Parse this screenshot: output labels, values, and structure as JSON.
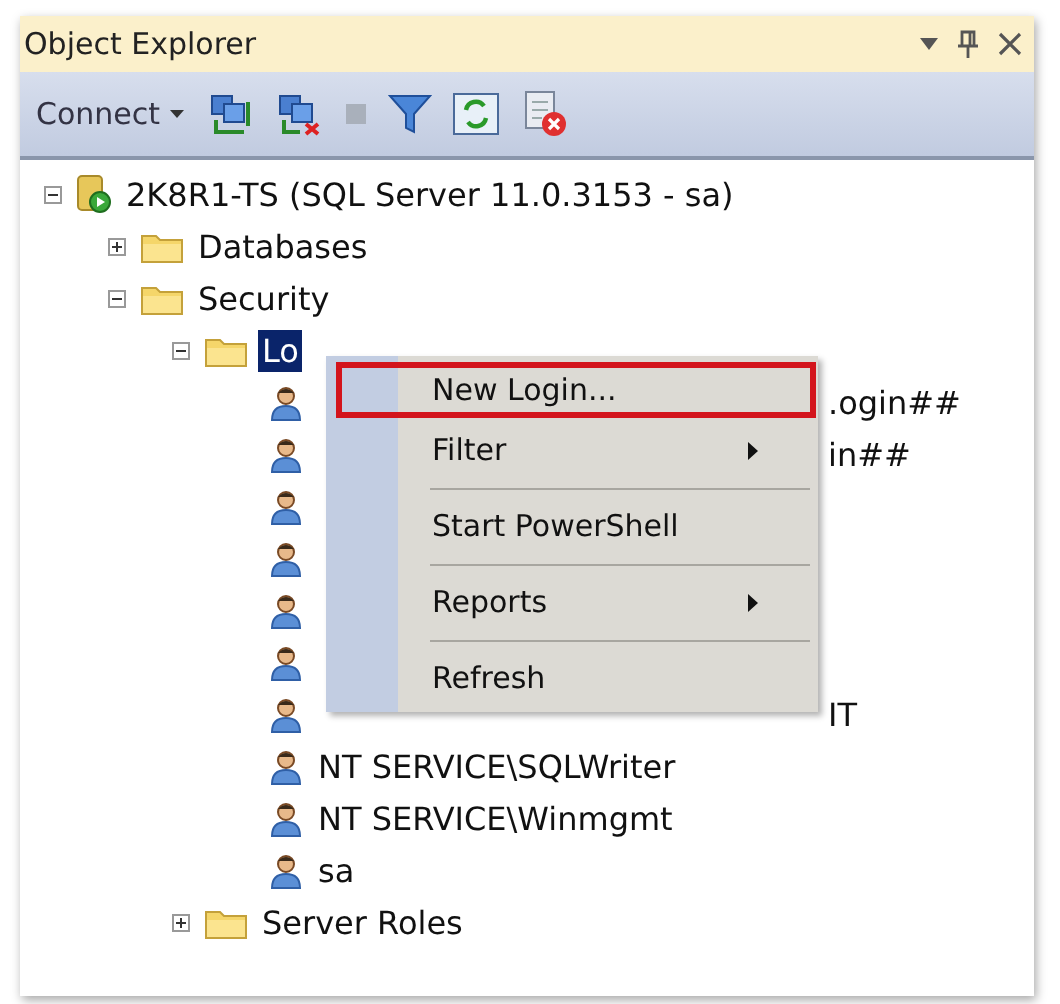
{
  "panel": {
    "title": "Object Explorer"
  },
  "toolbar": {
    "connect_label": "Connect"
  },
  "tree": [
    {
      "label": "2K8R1-TS (SQL Server 11.0.3153 - sa)",
      "kind": "server",
      "expanded": true,
      "selected": false,
      "children": [
        {
          "label": "Databases",
          "kind": "folder",
          "expanded": false,
          "selected": false
        },
        {
          "label": "Security",
          "kind": "folder",
          "expanded": true,
          "selected": false,
          "children": [
            {
              "label": "Lo",
              "kind": "folder",
              "expanded": true,
              "selected": true,
              "children": [
                {
                  "label": ".ogin##",
                  "kind": "login",
                  "covered": true,
                  "selected": false
                },
                {
                  "label": "in##",
                  "kind": "login",
                  "covered": true,
                  "selected": false
                },
                {
                  "kind": "login"
                },
                {
                  "kind": "login"
                },
                {
                  "kind": "login"
                },
                {
                  "kind": "login"
                },
                {
                  "label": "IT",
                  "kind": "login",
                  "covered": true,
                  "selected": false
                },
                {
                  "label": "NT SERVICE\\SQLWriter",
                  "kind": "login",
                  "covered": false,
                  "selected": false
                },
                {
                  "label": "NT SERVICE\\Winmgmt",
                  "kind": "login",
                  "covered": false,
                  "selected": false
                },
                {
                  "label": "sa",
                  "kind": "login",
                  "covered": false,
                  "selected": false
                }
              ]
            },
            {
              "label": "Server Roles",
              "kind": "folder",
              "expanded": false,
              "selected": false
            }
          ]
        }
      ]
    }
  ],
  "context_menu": [
    {
      "kind": "item",
      "label": "New Login...",
      "submenu": false,
      "highlighted": true
    },
    {
      "kind": "item",
      "label": "Filter",
      "submenu": true,
      "highlighted": false
    },
    {
      "kind": "separator"
    },
    {
      "kind": "item",
      "label": "Start PowerShell",
      "submenu": false,
      "highlighted": false
    },
    {
      "kind": "separator"
    },
    {
      "kind": "item",
      "label": "Reports",
      "submenu": true,
      "highlighted": false
    },
    {
      "kind": "separator"
    },
    {
      "kind": "item",
      "label": "Refresh",
      "submenu": false,
      "highlighted": false
    }
  ]
}
